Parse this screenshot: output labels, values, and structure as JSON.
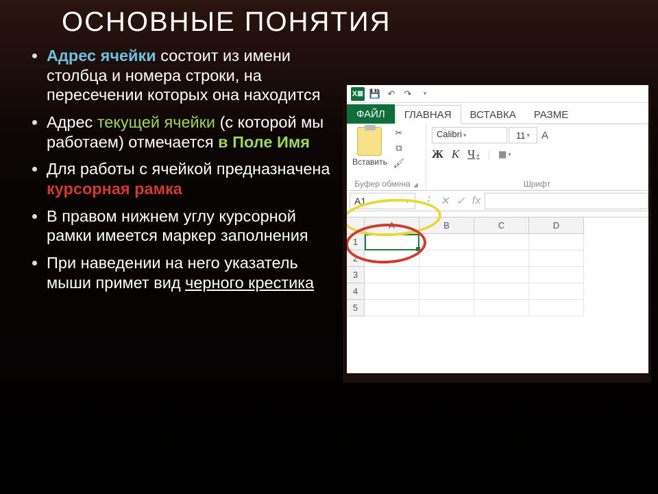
{
  "title": "ОСНОВНЫЕ ПОНЯТИЯ",
  "bullets": {
    "b1_hl": "Адрес ячейки",
    "b1_rest": " состоит из имени столбца и номера строки, на пересечении которых она находится",
    "b2_pre": "Адрес ",
    "b2_hl": "текущей ячейки",
    "b2_mid": " (с которой мы работаем) отмечается ",
    "b2_hl2": "в Поле Имя",
    "b3_pre": "Для работы с ячейкой предназначена ",
    "b3_hl": "курсорная рамка",
    "b4": "В правом нижнем углу курсорной рамки имеется маркер заполнения",
    "b5_pre": "При наведении на него указатель мыши примет вид ",
    "b5_u": "черного крестика"
  },
  "excel": {
    "tabs": {
      "file": "ФАЙЛ",
      "home": "ГЛАВНАЯ",
      "insert": "ВСТАВКА",
      "layout": "РАЗМЕ"
    },
    "paste_label": "Вставить",
    "font_name": "Calibri",
    "font_size": "11",
    "bold": "Ж",
    "italic": "К",
    "underline": "Ч",
    "group_clipboard": "Буфер обмена",
    "group_font": "Шрифт",
    "name_box": "A1",
    "fx": "fx",
    "cols": [
      "A",
      "B",
      "C",
      "D"
    ],
    "rows": [
      "1",
      "2",
      "3",
      "4",
      "5"
    ]
  }
}
